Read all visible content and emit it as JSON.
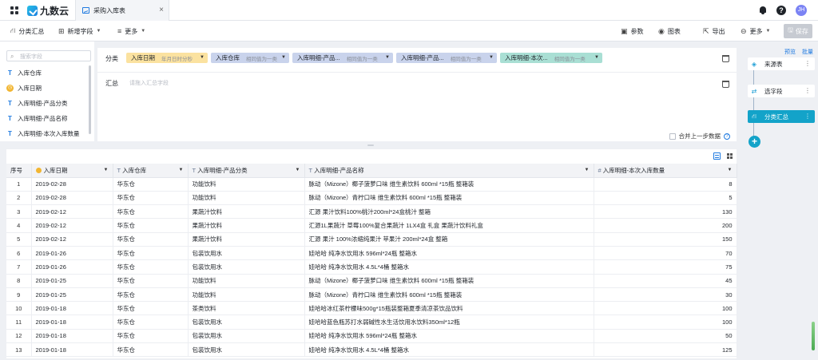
{
  "app": {
    "logo_text": "九数云",
    "tab_title": "采购入库表",
    "avatar_text": "JH"
  },
  "toolbar": {
    "group_summary": "分类汇总",
    "add_field": "新增字段",
    "more_left": "更多",
    "params": "参数",
    "chart": "图表",
    "export": "导出",
    "more_right": "更多",
    "save": "保存"
  },
  "sidebar": {
    "search_placeholder": "搜索字段",
    "fields": [
      "入库仓库",
      "入库日期",
      "入库明细-产品分类",
      "入库明细-产品名称",
      "入库明细-本次入库数量"
    ]
  },
  "config": {
    "group_label": "分类",
    "summary_label": "汇总",
    "summary_placeholder": "请拖入汇总字段",
    "chips": [
      {
        "name": "入库日期",
        "hint": "年月日时分秒"
      },
      {
        "name": "入库仓库",
        "hint": "相同值为一类"
      },
      {
        "name": "入库明细-产品...",
        "hint": "相同值为一类"
      },
      {
        "name": "入库明细-产品...",
        "hint": "相同值为一类"
      },
      {
        "name": "入库明细-本次...",
        "hint": "相同值为一类"
      }
    ],
    "merge_label": "合并上一步数据"
  },
  "table": {
    "headers": [
      "序号",
      "入库日期",
      "入库仓库",
      "入库明细-产品分类",
      "入库明细-产品名称",
      "入库明细-本次入库数量"
    ],
    "rows": [
      [
        "1",
        "2019-02-28",
        "华东仓",
        "功能饮料",
        "脉动（Mizone）椰子菠萝口味 维生素饮料 600ml *15瓶 整箱装",
        "8"
      ],
      [
        "2",
        "2019-02-28",
        "华东仓",
        "功能饮料",
        "脉动（Mizone）青柠口味 维生素饮料 600ml *15瓶 整箱装",
        "5"
      ],
      [
        "3",
        "2019-02-12",
        "华东仓",
        "果蔬汁饮料",
        "汇源 果汁饮料100%桃汁200ml*24盒桃汁 整箱",
        "130"
      ],
      [
        "4",
        "2019-02-12",
        "华东仓",
        "果蔬汁饮料",
        "汇源1L果蔬汁 草莓100%复合果蔬汁 1LX4盒 礼盒 果蔬汁饮料礼盒",
        "200"
      ],
      [
        "5",
        "2019-02-12",
        "华东仓",
        "果蔬汁饮料",
        "汇源 果汁 100%浓缩纯果汁 苹果汁 200ml*24盒 整箱",
        "150"
      ],
      [
        "6",
        "2019-01-26",
        "华东仓",
        "包装饮用水",
        "娃哈哈 纯净水饮用水 596ml*24瓶 整箱水",
        "70"
      ],
      [
        "7",
        "2019-01-26",
        "华东仓",
        "包装饮用水",
        "娃哈哈 纯净水饮用水 4.5L*4桶 整箱水",
        "75"
      ],
      [
        "8",
        "2019-01-25",
        "华东仓",
        "功能饮料",
        "脉动（Mizone）椰子菠萝口味 维生素饮料 600ml *15瓶 整箱装",
        "45"
      ],
      [
        "9",
        "2019-01-25",
        "华东仓",
        "功能饮料",
        "脉动（Mizone）青柠口味 维生素饮料 600ml *15瓶 整箱装",
        "30"
      ],
      [
        "10",
        "2019-01-18",
        "华东仓",
        "茶类饮料",
        "娃哈哈冰红茶柠檬味500g*15瓶装整箱夏季清凉茶饮品饮料",
        "100"
      ],
      [
        "11",
        "2019-01-18",
        "华东仓",
        "包装饮用水",
        "娃哈哈蓝色瓶苏打水弱碱性水生活饮用水饮料350ml*12瓶",
        "100"
      ],
      [
        "12",
        "2019-01-18",
        "华东仓",
        "包装饮用水",
        "娃哈哈 纯净水饮用水 596ml*24瓶 整箱水",
        "50"
      ],
      [
        "13",
        "2019-01-18",
        "华东仓",
        "包装饮用水",
        "娃哈哈 纯净水饮用水 4.5L*4桶 整箱水",
        "125"
      ]
    ]
  },
  "flow": {
    "preview": "预览",
    "batch": "批量",
    "nodes": [
      "来源表",
      "选字段",
      "分类汇总"
    ]
  },
  "colors": {
    "accent": "#1f7ae0",
    "flow_active": "#13a3c9",
    "chip_date": "#fbe2a0",
    "chip_blue": "#c9d3ec",
    "chip_green": "#a9dfd4"
  }
}
